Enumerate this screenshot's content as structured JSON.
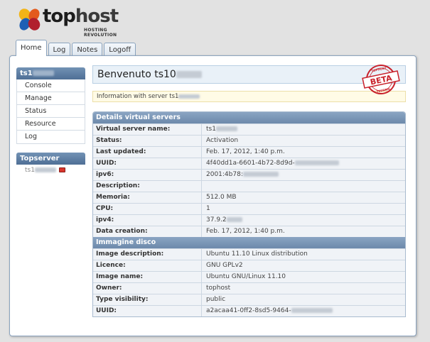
{
  "brand": {
    "name_part1": "top",
    "name_part2": "host",
    "tagline": "HOSTING REVOLUTION"
  },
  "tabs": [
    {
      "label": "Home",
      "active": true
    },
    {
      "label": "Log",
      "active": false
    },
    {
      "label": "Notes",
      "active": false
    },
    {
      "label": "Logoff",
      "active": false
    }
  ],
  "sidebar": {
    "server_title": "ts1",
    "items": [
      "Console",
      "Manage",
      "Status",
      "Resource",
      "Log"
    ],
    "topserver_title": "Topserver",
    "topserver_item": "ts1"
  },
  "main": {
    "welcome": "Benvenuto ts10",
    "info": "Information with server ts1",
    "beta_top": "TOPHOST",
    "beta_label": "BETA",
    "beta_bottom": "TESTING"
  },
  "details": {
    "title": "Details virtual servers",
    "rows": [
      {
        "label": "Virtual server name:",
        "value": "ts1"
      },
      {
        "label": "Status:",
        "value": "Activation"
      },
      {
        "label": "Last updated:",
        "value": "Feb. 17, 2012, 1:40 p.m."
      },
      {
        "label": "UUID:",
        "value": "4f40dd1a-6601-4b72-8d9d-"
      },
      {
        "label": "ipv6:",
        "value": "2001:4b78:"
      },
      {
        "label": "Description:",
        "value": ""
      },
      {
        "label": "Memoria:",
        "value": "512.0 MB"
      },
      {
        "label": "CPU:",
        "value": "1"
      },
      {
        "label": "ipv4:",
        "value": "37.9.2"
      },
      {
        "label": "Data creation:",
        "value": "Feb. 17, 2012, 1:40 p.m."
      }
    ]
  },
  "image": {
    "title": "Immagine disco",
    "rows": [
      {
        "label": "Image description:",
        "value": "Ubuntu 11.10 Linux distribution"
      },
      {
        "label": "Licence:",
        "value": "GNU GPLv2"
      },
      {
        "label": "Image name:",
        "value": "Ubuntu GNU/Linux 11.10"
      },
      {
        "label": "Owner:",
        "value": "tophost"
      },
      {
        "label": "Type visibility:",
        "value": "public"
      },
      {
        "label": "UUID:",
        "value": "a2acaa41-0ff2-8sd5-9464-"
      }
    ]
  },
  "colors": {
    "header_blue": "#6c89ab",
    "sidebar_blue": "#5a7aa0",
    "beta_red": "#c8202a"
  }
}
